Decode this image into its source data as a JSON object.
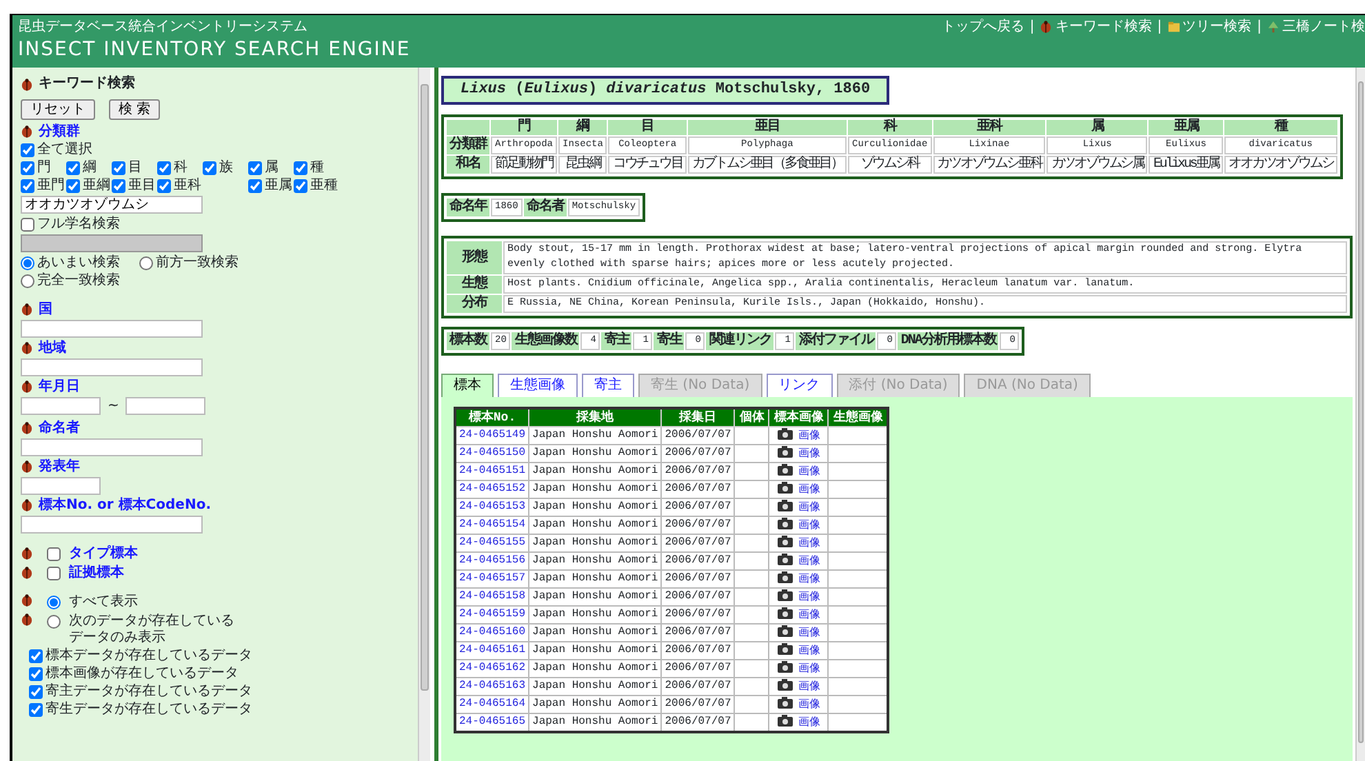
{
  "header": {
    "subtitle": "昆虫データベース統合インベントリーシステム",
    "title": "INSECT INVENTORY SEARCH ENGINE",
    "nav": [
      {
        "kind": "link",
        "label": "トップへ戻る"
      },
      {
        "kind": "separator",
        "label": "|"
      },
      {
        "kind": "link_bug",
        "label": "キーワード検索"
      },
      {
        "kind": "separator",
        "label": "|"
      },
      {
        "kind": "link_folder",
        "label": "ツリー検索"
      },
      {
        "kind": "separator",
        "label": "|"
      },
      {
        "kind": "link_tree",
        "label": "三橋ノート検"
      }
    ]
  },
  "sidebar": {
    "items": [
      {
        "kind": "heading",
        "label": "キーワード検索",
        "link": false
      },
      {
        "kind": "buttons",
        "buttons": [
          "リセット",
          "検 索"
        ]
      },
      {
        "kind": "heading",
        "label": "分類群",
        "link": true
      },
      {
        "kind": "check",
        "label": "全て選択",
        "checked": true
      },
      {
        "kind": "check_grid",
        "rows": [
          [
            {
              "kind": "check",
              "label": "門",
              "checked": true
            },
            {
              "kind": "check",
              "label": "綱",
              "checked": true
            },
            {
              "kind": "check",
              "label": "目",
              "checked": true
            },
            {
              "kind": "check",
              "label": "科",
              "checked": true
            },
            {
              "kind": "check",
              "label": "族",
              "checked": true
            },
            {
              "kind": "check",
              "label": "属",
              "checked": true
            },
            {
              "kind": "check",
              "label": "種",
              "checked": true
            }
          ],
          [
            {
              "kind": "check",
              "label": "亜門",
              "checked": true
            },
            {
              "kind": "check",
              "label": "亜綱",
              "checked": true
            },
            {
              "kind": "check",
              "label": "亜目",
              "checked": true
            },
            {
              "kind": "check",
              "label": "亜科",
              "checked": true
            },
            {
              "kind": "gap"
            },
            {
              "kind": "check",
              "label": "亜属",
              "checked": true
            },
            {
              "kind": "check",
              "label": "亜種",
              "checked": true
            }
          ]
        ]
      },
      {
        "kind": "field",
        "value": "オオカツオゾウムシ",
        "disabled": false
      },
      {
        "kind": "check",
        "label": "フル学名検索",
        "checked": false
      },
      {
        "kind": "field",
        "disabled": true
      },
      {
        "kind": "radios",
        "options": [
          {
            "label": "あいまい検索",
            "selected": true
          },
          {
            "label": "前方一致検索",
            "selected": false
          },
          {
            "label": "完全一致検索",
            "selected": false
          }
        ]
      },
      {
        "kind": "heading",
        "label": "国",
        "link": true
      },
      {
        "kind": "field",
        "disabled": false
      },
      {
        "kind": "heading",
        "label": "地域",
        "link": true
      },
      {
        "kind": "field",
        "disabled": false
      },
      {
        "kind": "heading",
        "label": "年月日",
        "link": true
      },
      {
        "kind": "range",
        "separator": "~"
      },
      {
        "kind": "heading",
        "label": "命名者",
        "link": true
      },
      {
        "kind": "field",
        "disabled": false
      },
      {
        "kind": "heading",
        "label": "発表年",
        "link": true
      },
      {
        "kind": "field_short",
        "disabled": false
      },
      {
        "kind": "heading",
        "label": "標本No. or 標本CodeNo.",
        "link": true
      },
      {
        "kind": "field",
        "disabled": false
      },
      {
        "kind": "heading_check",
        "label": "タイプ標本",
        "checked": false
      },
      {
        "kind": "heading_check",
        "label": "証拠標本",
        "checked": false
      },
      {
        "kind": "heading_radio",
        "label": "すべて表示",
        "selected": true
      },
      {
        "kind": "heading_radio",
        "label": "次のデータが存在しているデータのみ表示",
        "selected": false
      },
      {
        "kind": "subcheck",
        "label": "標本データが存在しているデータ",
        "checked": true
      },
      {
        "kind": "subcheck",
        "label": "標本画像が存在しているデータ",
        "checked": true
      },
      {
        "kind": "subcheck",
        "label": "寄主データが存在しているデータ",
        "checked": true
      },
      {
        "kind": "subcheck",
        "label": "寄生データが存在しているデータ",
        "checked": true
      }
    ]
  },
  "species": {
    "name": "*Lixus* (*Eulixus*) *divaricatus* Motschulsky, 1860"
  },
  "taxonomy": {
    "columns": [
      "門",
      "綱",
      "目",
      "亜目",
      "科",
      "亜科",
      "属",
      "亜属",
      "種"
    ],
    "rows": [
      {
        "label": "分類群",
        "cells": [
          "Arthropoda",
          "Insecta",
          "Coleoptera",
          "Polyphaga",
          "Curculionidae",
          "Lixinae",
          "Lixus",
          "Eulixus",
          "divaricatus"
        ]
      },
      {
        "label": "和名",
        "cells": [
          "節足動物門",
          "昆虫綱",
          "コウチュウ目",
          "カブトムシ亜目（多食亜目）",
          "ゾウムシ科",
          "カツオゾウムシ亜科",
          "カツオゾウムシ属",
          "Eulixus亜属",
          "オオカツオゾウムシ"
        ]
      }
    ]
  },
  "naming": [
    {
      "label": "命名年",
      "value": "1860"
    },
    {
      "label": "命名者",
      "value": "Motschulsky"
    }
  ],
  "description": [
    {
      "label": "形態",
      "text": "Body stout, 15-17 mm in length. Prothorax widest at base; latero-ventral projections of apical margin rounded and strong. Elytra evenly clothed with sparse hairs; apices more or less acutely projected."
    },
    {
      "label": "生態",
      "text": "Host plants. Cnidium officinale, Angelica spp., Aralia continentalis, Heracleum lanatum var. lanatum."
    },
    {
      "label": "分布",
      "text": "E Russia, NE China, Korean Peninsula, Kurile Isls., Japan (Hokkaido, Honshu)."
    }
  ],
  "counts": [
    {
      "label": "標本数",
      "value": "20"
    },
    {
      "label": "生態画像数",
      "value": "4"
    },
    {
      "label": "寄主",
      "value": "1"
    },
    {
      "label": "寄生",
      "value": "0"
    },
    {
      "label": "関連リンク",
      "value": "1"
    },
    {
      "label": "添付ファイル",
      "value": "0"
    },
    {
      "label": "DNA分析用標本数",
      "value": "0"
    }
  ],
  "tabs": [
    {
      "label": "標本",
      "selected": true,
      "disabled": false
    },
    {
      "label": "生態画像",
      "selected": false,
      "disabled": false
    },
    {
      "label": "寄主",
      "selected": false,
      "disabled": false
    },
    {
      "label": "寄生 (No Data)",
      "selected": false,
      "disabled": true
    },
    {
      "label": "リンク",
      "selected": false,
      "disabled": false
    },
    {
      "label": "添付 (No Data)",
      "selected": false,
      "disabled": true
    },
    {
      "label": "DNA (No Data)",
      "selected": false,
      "disabled": true
    }
  ],
  "specimens": {
    "columns": [
      "標本No.",
      "採集地",
      "採集日",
      "個体",
      "標本画像",
      "生態画像"
    ],
    "rows": [
      {
        "no": "24-0465149",
        "locality": "Japan Honshu Aomori",
        "date": "2006/07/07",
        "image": "画像"
      },
      {
        "no": "24-0465150",
        "locality": "Japan Honshu Aomori",
        "date": "2006/07/07",
        "image": "画像"
      },
      {
        "no": "24-0465151",
        "locality": "Japan Honshu Aomori",
        "date": "2006/07/07",
        "image": "画像"
      },
      {
        "no": "24-0465152",
        "locality": "Japan Honshu Aomori",
        "date": "2006/07/07",
        "image": "画像"
      },
      {
        "no": "24-0465153",
        "locality": "Japan Honshu Aomori",
        "date": "2006/07/07",
        "image": "画像"
      },
      {
        "no": "24-0465154",
        "locality": "Japan Honshu Aomori",
        "date": "2006/07/07",
        "image": "画像"
      },
      {
        "no": "24-0465155",
        "locality": "Japan Honshu Aomori",
        "date": "2006/07/07",
        "image": "画像"
      },
      {
        "no": "24-0465156",
        "locality": "Japan Honshu Aomori",
        "date": "2006/07/07",
        "image": "画像"
      },
      {
        "no": "24-0465157",
        "locality": "Japan Honshu Aomori",
        "date": "2006/07/07",
        "image": "画像"
      },
      {
        "no": "24-0465158",
        "locality": "Japan Honshu Aomori",
        "date": "2006/07/07",
        "image": "画像"
      },
      {
        "no": "24-0465159",
        "locality": "Japan Honshu Aomori",
        "date": "2006/07/07",
        "image": "画像"
      },
      {
        "no": "24-0465160",
        "locality": "Japan Honshu Aomori",
        "date": "2006/07/07",
        "image": "画像"
      },
      {
        "no": "24-0465161",
        "locality": "Japan Honshu Aomori",
        "date": "2006/07/07",
        "image": "画像"
      },
      {
        "no": "24-0465162",
        "locality": "Japan Honshu Aomori",
        "date": "2006/07/07",
        "image": "画像"
      },
      {
        "no": "24-0465163",
        "locality": "Japan Honshu Aomori",
        "date": "2006/07/07",
        "image": "画像"
      },
      {
        "no": "24-0465164",
        "locality": "Japan Honshu Aomori",
        "date": "2006/07/07",
        "image": "画像"
      },
      {
        "no": "24-0465165",
        "locality": "Japan Honshu Aomori",
        "date": "2006/07/07",
        "image": "画像"
      }
    ]
  }
}
